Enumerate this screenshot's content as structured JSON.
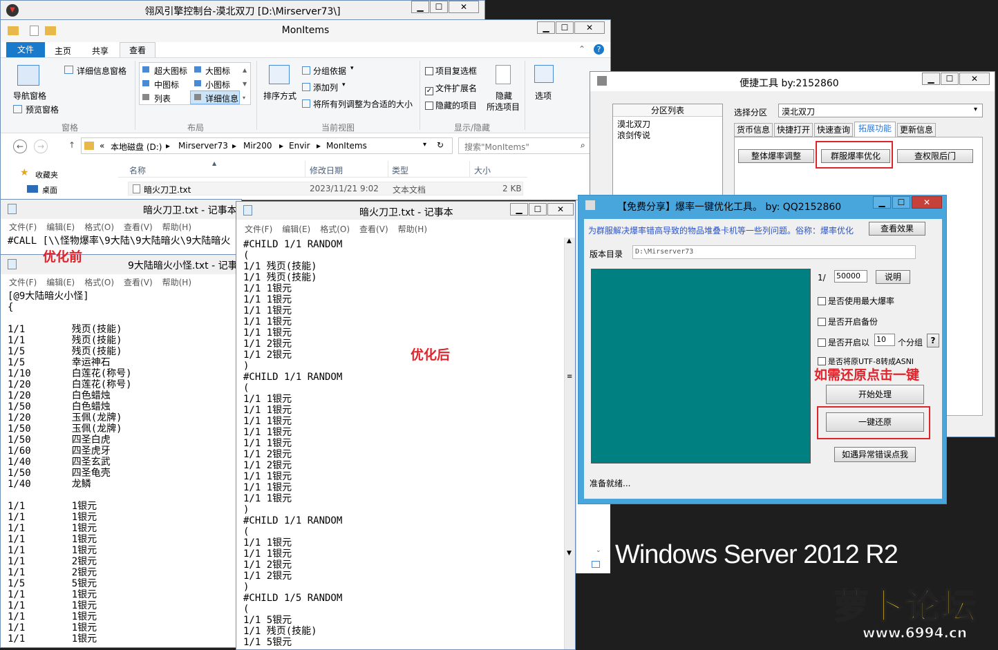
{
  "engine_console": {
    "title": "翎风引擎控制台-漠北双刀 [D:\\Mirserver73\\]"
  },
  "explorer": {
    "title": "MonItems",
    "tabs": [
      "文件",
      "主页",
      "共享",
      "查看"
    ],
    "ribbon": {
      "nav_pane": "导航窗格",
      "preview_pane": "预览窗格",
      "details_pane": "详细信息窗格",
      "pane_group": "窗格",
      "layout_items": [
        "超大图标",
        "大图标",
        "中图标",
        "小图标",
        "列表",
        "详细信息"
      ],
      "layout_group": "布局",
      "sort_by": "排序方式",
      "group_by": "分组依据",
      "add_column": "添加列",
      "fit_columns": "将所有列调整为合适的大小",
      "current_view_group": "当前视图",
      "item_checkbox": "项目复选框",
      "file_ext": "文件扩展名",
      "hidden_items": "隐藏的项目",
      "hide_selected_a": "隐藏",
      "hide_selected_b": "所选项目",
      "show_hide_group": "显示/隐藏",
      "options": "选项"
    },
    "breadcrumb": [
      "«",
      "本地磁盘 (D:)",
      "Mirserver73",
      "Mir200",
      "Envir",
      "MonItems"
    ],
    "search_placeholder": "搜索\"MonItems\"",
    "columns": [
      "名称",
      "修改日期",
      "类型",
      "大小"
    ],
    "nav": {
      "favorites": "收藏夹",
      "desktop": "桌面"
    },
    "file": {
      "name": "暗火刀卫.txt",
      "date": "2023/11/21 9:02",
      "type": "文本文档",
      "size": "2 KB"
    }
  },
  "notepad_menu": [
    "文件(F)",
    "编辑(E)",
    "格式(O)",
    "查看(V)",
    "帮助(H)"
  ],
  "notepad1": {
    "title": "暗火刀卫.txt - 记事本",
    "content": "#CALL [\\\\怪物爆率\\9大陆\\9大陆暗火\\9大陆暗火"
  },
  "notepad2": {
    "title": "9大陆暗火小怪.txt - 记事本",
    "lines": [
      "[@9大陆暗火小怪]",
      "{",
      "",
      "1/1        残页(技能)",
      "1/1        残页(技能)",
      "1/5        残页(技能)",
      "1/5        幸运神石",
      "1/10       白莲花(称号)",
      "1/20       白莲花(称号)",
      "1/20       白色蜡烛",
      "1/50       白色蜡烛",
      "1/20       玉佩(龙牌)",
      "1/50       玉佩(龙牌)",
      "1/50       四圣白虎",
      "1/60       四圣虎牙",
      "1/40       四圣玄武",
      "1/50       四圣龟壳",
      "1/40       龙鳞",
      "",
      "1/1        1银元",
      "1/1        1银元",
      "1/1        1银元",
      "1/1        1银元",
      "1/1        1银元",
      "1/1        2银元",
      "1/1        2银元",
      "1/5        5银元",
      "1/1        1银元",
      "1/1        1银元",
      "1/1        1银元",
      "1/1        1银元",
      "1/1        1银元"
    ]
  },
  "notepad3": {
    "title": "暗火刀卫.txt - 记事本",
    "lines": [
      "#CHILD 1/1 RANDOM",
      "(",
      "1/1 残页(技能)",
      "1/1 残页(技能)",
      "1/1 1银元",
      "1/1 1银元",
      "1/1 1银元",
      "1/1 1银元",
      "1/1 1银元",
      "1/1 2银元",
      "1/1 2银元",
      ")",
      "#CHILD 1/1 RANDOM",
      "(",
      "1/1 1银元",
      "1/1 1银元",
      "1/1 1银元",
      "1/1 1银元",
      "1/1 1银元",
      "1/1 2银元",
      "1/1 2银元",
      "1/1 1银元",
      "1/1 1银元",
      "1/1 1银元",
      ")",
      "#CHILD 1/1 RANDOM",
      "(",
      "1/1 1银元",
      "1/1 1银元",
      "1/1 2银元",
      "1/1 2银元",
      ")",
      "#CHILD 1/5 RANDOM",
      "(",
      "1/1 5银元",
      "1/1 残页(技能)",
      "1/1 5银元"
    ]
  },
  "quick_tool": {
    "title": "便捷工具 by:2152860",
    "zone_list_header": "分区列表",
    "zones": [
      "漠北双刀",
      "浪剑传说"
    ],
    "select_zone_label": "选择分区",
    "selected_zone": "漠北双刀",
    "tabs": [
      "货币信息",
      "快捷打开",
      "快速查询",
      "拓展功能",
      "更新信息"
    ],
    "buttons": [
      "整体爆率调整",
      "群服爆率优化",
      "查权限后门"
    ]
  },
  "optimizer": {
    "title": "【免费分享】爆率一键优化工具。 by: QQ2152860",
    "description": "为群服解决爆率错高导致的物品堆叠卡机等一些列问题。俗称：爆率优化",
    "view_effect": "查看效果",
    "version_dir_label": "版本目录",
    "version_dir": "D:\\Mirserver73",
    "ratio_prefix": "1/",
    "ratio_value": "50000",
    "explain": "说明",
    "opt_max": "是否使用最大爆率",
    "opt_backup": "是否开启备份",
    "opt_split_a": "是否开启以",
    "split_value": "10",
    "opt_split_b": "个分组",
    "help_q": "?",
    "opt_utf8": "是否将原UTF-8转成ASNI",
    "start": "开始处理",
    "restore": "一键还原",
    "error_click": "如遇异常错误点我",
    "status": "准备就绪..."
  },
  "annotations": {
    "before": "优化前",
    "after": "优化后",
    "restore_hint": "如需还原点击一键"
  },
  "watermark": {
    "os": "Windows Server 2012 R2",
    "logo_text": "萝卜论坛",
    "logo_url": "www.6994.cn"
  },
  "colors": {
    "teal": "#008080",
    "accent_blue": "#2b78d6",
    "red": "#e0232b"
  }
}
